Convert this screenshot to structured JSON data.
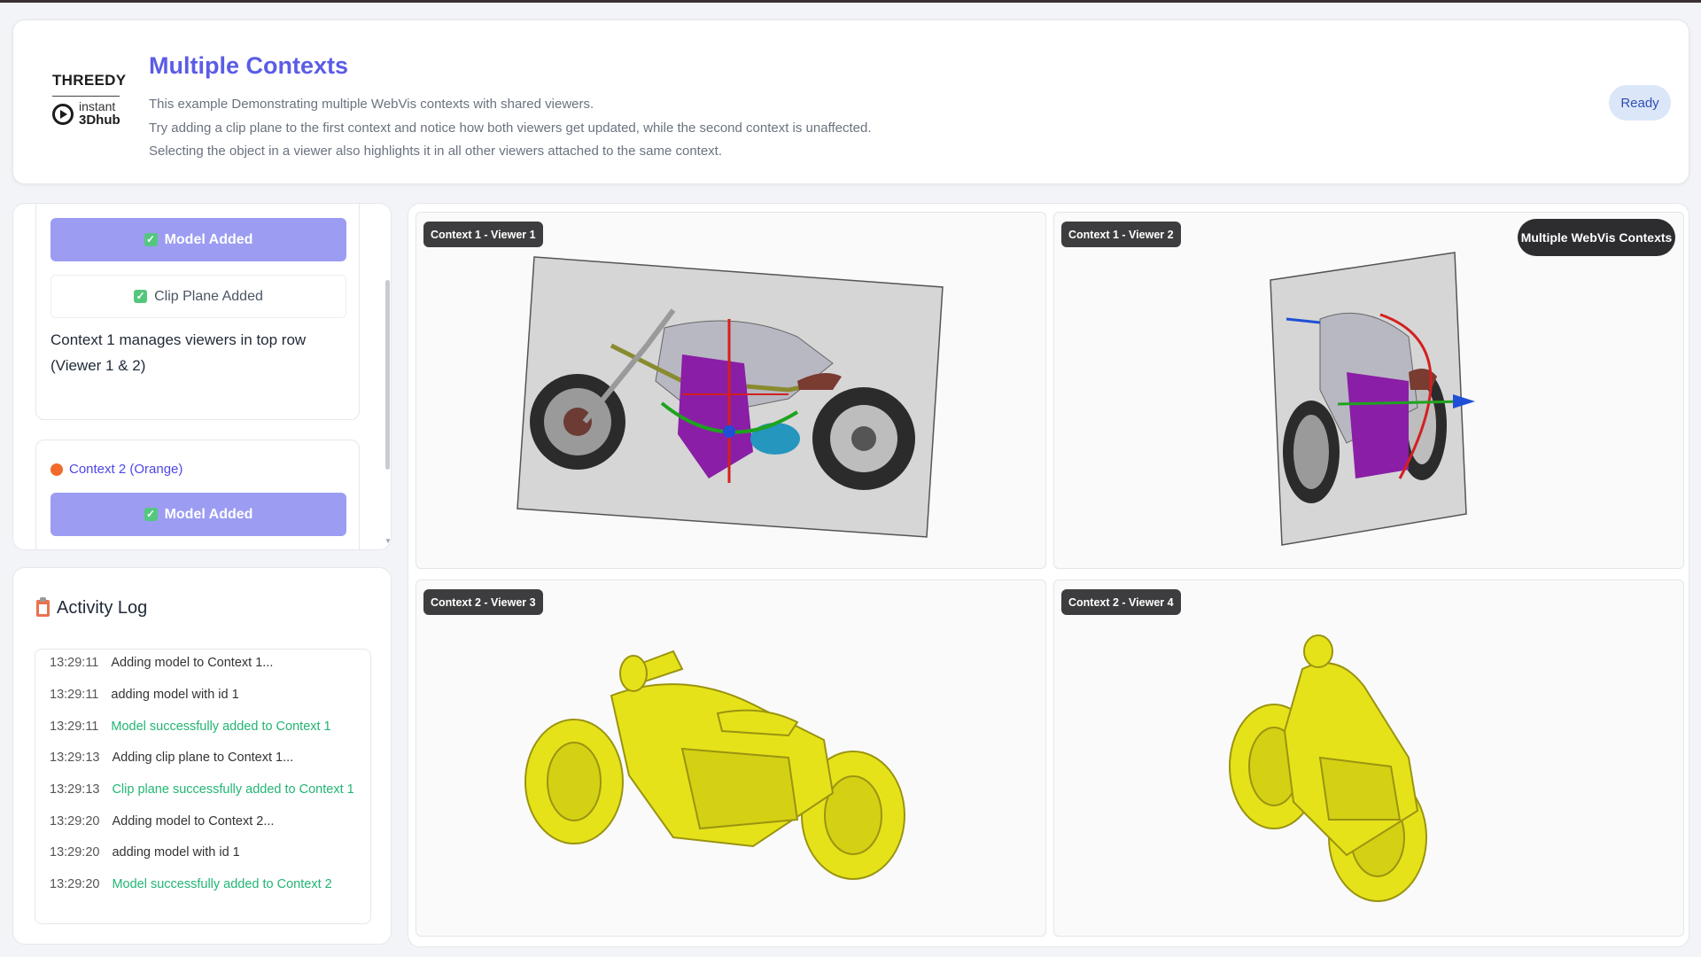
{
  "header": {
    "logo_top": "THREEDY",
    "logo_bottom_1": "instant",
    "logo_bottom_2": "3Dhub",
    "title": "Multiple Contexts",
    "description": [
      "This example Demonstrating multiple WebVis contexts with shared viewers.",
      "Try adding a clip plane to the first context and notice how both viewers get updated, while the second context is unaffected.",
      "Selecting the object in a viewer also highlights it in all other viewers attached to the same context."
    ],
    "status": "Ready"
  },
  "controls": {
    "context1": {
      "model_button": "Model Added",
      "clip_button": "Clip Plane Added",
      "note": "Context 1 manages viewers in top row (Viewer 1 & 2)"
    },
    "context2": {
      "label": "Context 2 (Orange)",
      "model_button": "Model Added"
    }
  },
  "activity_log": {
    "title": "Activity Log",
    "entries": [
      {
        "time": "13:29:11",
        "message": "Adding model to Context 1...",
        "status": "info"
      },
      {
        "time": "13:29:11",
        "message": "adding model with id 1",
        "status": "info"
      },
      {
        "time": "13:29:11",
        "message": "Model successfully added to Context 1",
        "status": "success"
      },
      {
        "time": "13:29:13",
        "message": "Adding clip plane to Context 1...",
        "status": "info"
      },
      {
        "time": "13:29:13",
        "message": "Clip plane successfully added to Context 1",
        "status": "success"
      },
      {
        "time": "13:29:20",
        "message": "Adding model to Context 2...",
        "status": "info"
      },
      {
        "time": "13:29:20",
        "message": "adding model with id 1",
        "status": "info"
      },
      {
        "time": "13:29:20",
        "message": "Model successfully added to Context 2",
        "status": "success"
      }
    ]
  },
  "viewers": {
    "badge": "Multiple WebVis Contexts",
    "labels": [
      "Context 1 - Viewer 1",
      "Context 1 - Viewer 2",
      "Context 2 - Viewer 3",
      "Context 2 - Viewer 4"
    ]
  },
  "colors": {
    "accent": "#5b5ce6",
    "button_primary": "#9b9cf2",
    "success": "#22b573",
    "model_context2": "#e6e21a",
    "context2_dot": "#f06a2b"
  }
}
